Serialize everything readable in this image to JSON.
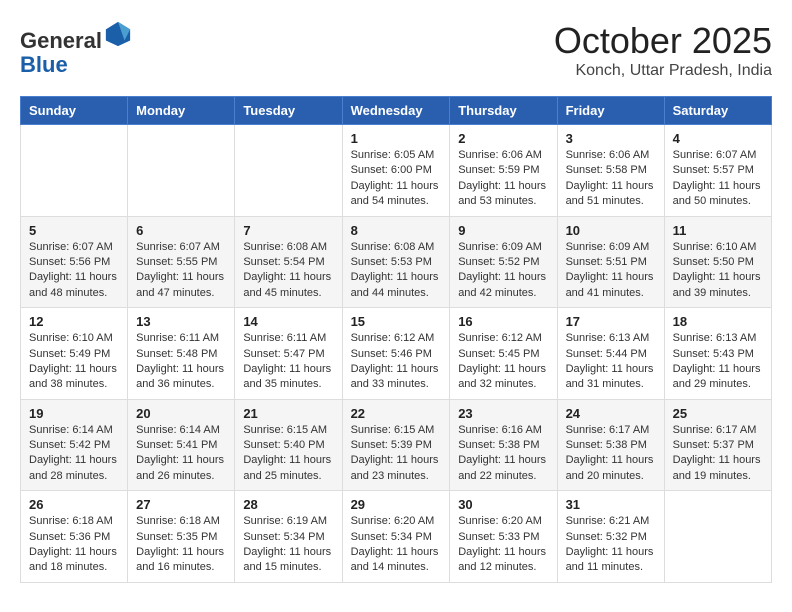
{
  "header": {
    "logo_general": "General",
    "logo_blue": "Blue",
    "month_title": "October 2025",
    "location": "Konch, Uttar Pradesh, India"
  },
  "weekdays": [
    "Sunday",
    "Monday",
    "Tuesday",
    "Wednesday",
    "Thursday",
    "Friday",
    "Saturday"
  ],
  "weeks": [
    [
      {
        "day": "",
        "info": ""
      },
      {
        "day": "",
        "info": ""
      },
      {
        "day": "",
        "info": ""
      },
      {
        "day": "1",
        "info": "Sunrise: 6:05 AM\nSunset: 6:00 PM\nDaylight: 11 hours\nand 54 minutes."
      },
      {
        "day": "2",
        "info": "Sunrise: 6:06 AM\nSunset: 5:59 PM\nDaylight: 11 hours\nand 53 minutes."
      },
      {
        "day": "3",
        "info": "Sunrise: 6:06 AM\nSunset: 5:58 PM\nDaylight: 11 hours\nand 51 minutes."
      },
      {
        "day": "4",
        "info": "Sunrise: 6:07 AM\nSunset: 5:57 PM\nDaylight: 11 hours\nand 50 minutes."
      }
    ],
    [
      {
        "day": "5",
        "info": "Sunrise: 6:07 AM\nSunset: 5:56 PM\nDaylight: 11 hours\nand 48 minutes."
      },
      {
        "day": "6",
        "info": "Sunrise: 6:07 AM\nSunset: 5:55 PM\nDaylight: 11 hours\nand 47 minutes."
      },
      {
        "day": "7",
        "info": "Sunrise: 6:08 AM\nSunset: 5:54 PM\nDaylight: 11 hours\nand 45 minutes."
      },
      {
        "day": "8",
        "info": "Sunrise: 6:08 AM\nSunset: 5:53 PM\nDaylight: 11 hours\nand 44 minutes."
      },
      {
        "day": "9",
        "info": "Sunrise: 6:09 AM\nSunset: 5:52 PM\nDaylight: 11 hours\nand 42 minutes."
      },
      {
        "day": "10",
        "info": "Sunrise: 6:09 AM\nSunset: 5:51 PM\nDaylight: 11 hours\nand 41 minutes."
      },
      {
        "day": "11",
        "info": "Sunrise: 6:10 AM\nSunset: 5:50 PM\nDaylight: 11 hours\nand 39 minutes."
      }
    ],
    [
      {
        "day": "12",
        "info": "Sunrise: 6:10 AM\nSunset: 5:49 PM\nDaylight: 11 hours\nand 38 minutes."
      },
      {
        "day": "13",
        "info": "Sunrise: 6:11 AM\nSunset: 5:48 PM\nDaylight: 11 hours\nand 36 minutes."
      },
      {
        "day": "14",
        "info": "Sunrise: 6:11 AM\nSunset: 5:47 PM\nDaylight: 11 hours\nand 35 minutes."
      },
      {
        "day": "15",
        "info": "Sunrise: 6:12 AM\nSunset: 5:46 PM\nDaylight: 11 hours\nand 33 minutes."
      },
      {
        "day": "16",
        "info": "Sunrise: 6:12 AM\nSunset: 5:45 PM\nDaylight: 11 hours\nand 32 minutes."
      },
      {
        "day": "17",
        "info": "Sunrise: 6:13 AM\nSunset: 5:44 PM\nDaylight: 11 hours\nand 31 minutes."
      },
      {
        "day": "18",
        "info": "Sunrise: 6:13 AM\nSunset: 5:43 PM\nDaylight: 11 hours\nand 29 minutes."
      }
    ],
    [
      {
        "day": "19",
        "info": "Sunrise: 6:14 AM\nSunset: 5:42 PM\nDaylight: 11 hours\nand 28 minutes."
      },
      {
        "day": "20",
        "info": "Sunrise: 6:14 AM\nSunset: 5:41 PM\nDaylight: 11 hours\nand 26 minutes."
      },
      {
        "day": "21",
        "info": "Sunrise: 6:15 AM\nSunset: 5:40 PM\nDaylight: 11 hours\nand 25 minutes."
      },
      {
        "day": "22",
        "info": "Sunrise: 6:15 AM\nSunset: 5:39 PM\nDaylight: 11 hours\nand 23 minutes."
      },
      {
        "day": "23",
        "info": "Sunrise: 6:16 AM\nSunset: 5:38 PM\nDaylight: 11 hours\nand 22 minutes."
      },
      {
        "day": "24",
        "info": "Sunrise: 6:17 AM\nSunset: 5:38 PM\nDaylight: 11 hours\nand 20 minutes."
      },
      {
        "day": "25",
        "info": "Sunrise: 6:17 AM\nSunset: 5:37 PM\nDaylight: 11 hours\nand 19 minutes."
      }
    ],
    [
      {
        "day": "26",
        "info": "Sunrise: 6:18 AM\nSunset: 5:36 PM\nDaylight: 11 hours\nand 18 minutes."
      },
      {
        "day": "27",
        "info": "Sunrise: 6:18 AM\nSunset: 5:35 PM\nDaylight: 11 hours\nand 16 minutes."
      },
      {
        "day": "28",
        "info": "Sunrise: 6:19 AM\nSunset: 5:34 PM\nDaylight: 11 hours\nand 15 minutes."
      },
      {
        "day": "29",
        "info": "Sunrise: 6:20 AM\nSunset: 5:34 PM\nDaylight: 11 hours\nand 14 minutes."
      },
      {
        "day": "30",
        "info": "Sunrise: 6:20 AM\nSunset: 5:33 PM\nDaylight: 11 hours\nand 12 minutes."
      },
      {
        "day": "31",
        "info": "Sunrise: 6:21 AM\nSunset: 5:32 PM\nDaylight: 11 hours\nand 11 minutes."
      },
      {
        "day": "",
        "info": ""
      }
    ]
  ]
}
